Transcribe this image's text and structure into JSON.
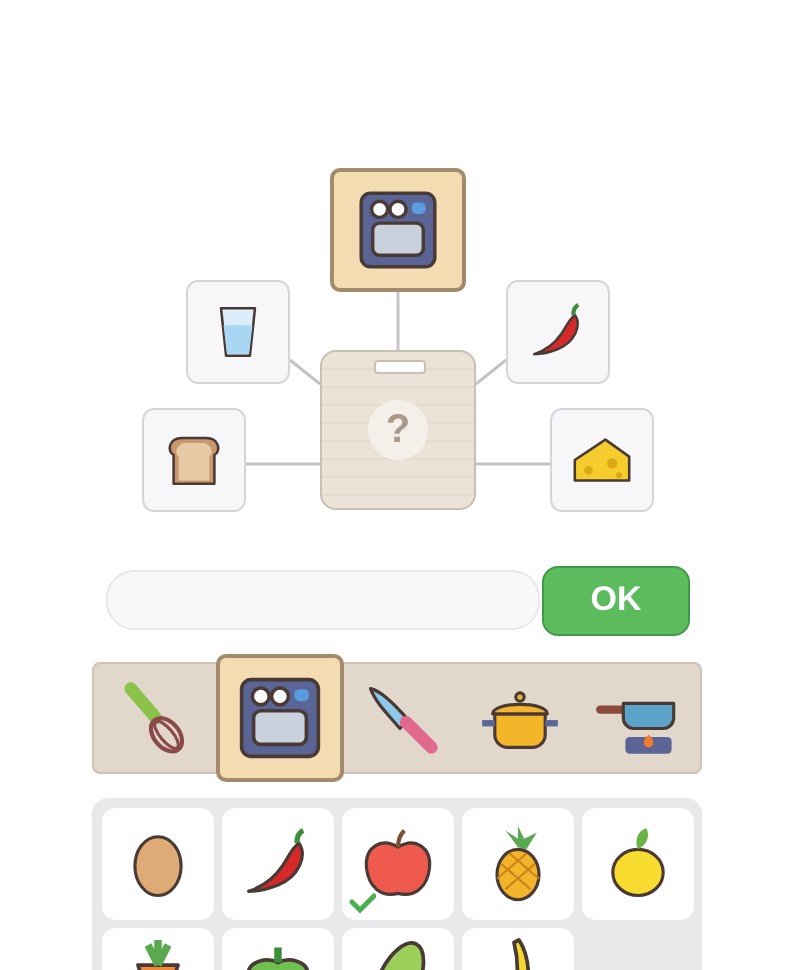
{
  "recipe": {
    "result": {
      "text": "?"
    },
    "tool": {
      "kind": "oven"
    },
    "inputs": [
      {
        "kind": "glass"
      },
      {
        "kind": "chili"
      },
      {
        "kind": "bread"
      },
      {
        "kind": "cheese"
      }
    ]
  },
  "answer": {
    "button": "OK"
  },
  "tools": [
    {
      "kind": "whisk",
      "selected": false
    },
    {
      "kind": "oven",
      "selected": true
    },
    {
      "kind": "knife",
      "selected": false
    },
    {
      "kind": "pot",
      "selected": false
    },
    {
      "kind": "stove",
      "selected": false
    }
  ],
  "ingredients": [
    {
      "kind": "egg",
      "checked": false
    },
    {
      "kind": "chili",
      "checked": false
    },
    {
      "kind": "apple",
      "checked": true
    },
    {
      "kind": "pineapple",
      "checked": false
    },
    {
      "kind": "lemon",
      "checked": false
    },
    {
      "kind": "carrot",
      "checked": false
    },
    {
      "kind": "pepper",
      "checked": false
    },
    {
      "kind": "cucumber",
      "checked": false
    },
    {
      "kind": "banana",
      "checked": false
    }
  ]
}
